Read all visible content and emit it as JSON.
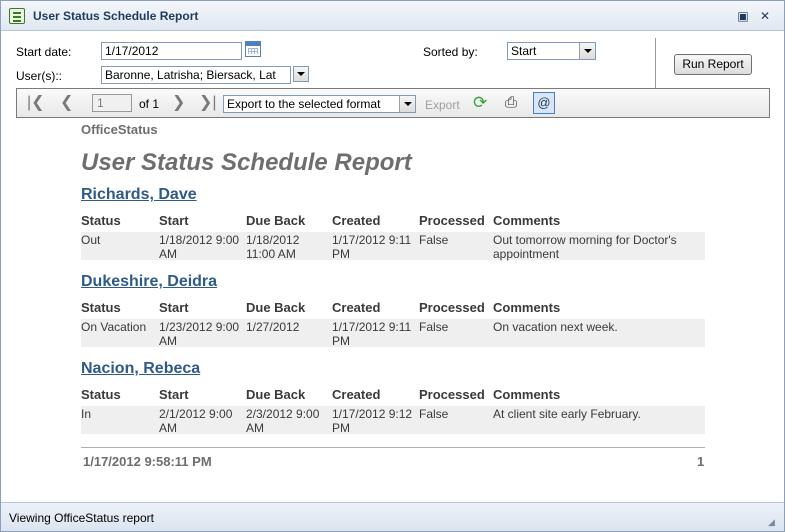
{
  "window": {
    "title": "User Status Schedule Report"
  },
  "params": {
    "start_date_label": "Start date:",
    "start_date_value": "1/17/2012",
    "users_label": "User(s)::",
    "users_value": "Baronne, Latrisha; Biersack, Lat",
    "sorted_by_label": "Sorted by:",
    "sorted_by_value": "Start",
    "run_report_label": "Run Report"
  },
  "toolbar": {
    "page_value": "1",
    "of_text": "of 1",
    "export_format": "Export to the selected format",
    "export_label": "Export"
  },
  "report": {
    "brand": "OfficeStatus",
    "title": "User Status Schedule Report",
    "columns": [
      "Status",
      "Start",
      "Due Back",
      "Created",
      "Processed",
      "Comments"
    ],
    "users": [
      {
        "name": "Richards, Dave",
        "status": "Out",
        "start": "1/18/2012 9:00 AM",
        "due_back": "1/18/2012 11:00 AM",
        "created": "1/17/2012 9:11 PM",
        "processed": "False",
        "comments": "Out tomorrow morning for Doctor's appointment"
      },
      {
        "name": "Dukeshire, Deidra",
        "status": "On Vacation",
        "start": "1/23/2012 9:00 AM",
        "due_back": "1/27/2012",
        "created": "1/17/2012 9:11 PM",
        "processed": "False",
        "comments": "On vacation next week."
      },
      {
        "name": "Nacion, Rebeca",
        "status": "In",
        "start": "2/1/2012 9:00 AM",
        "due_back": "2/3/2012 9:00 AM",
        "created": "1/17/2012 9:12 PM",
        "processed": "False",
        "comments": "At client site early February."
      }
    ],
    "footer_timestamp": "1/17/2012 9:58:11 PM",
    "footer_page": "1"
  },
  "status_bar": {
    "text": "Viewing OfficeStatus report"
  },
  "icons": {
    "first_page": "first-page-icon",
    "prev_page": "prev-page-icon",
    "next_page": "next-page-icon",
    "last_page": "last-page-icon",
    "refresh": "refresh-icon",
    "print": "printer-icon",
    "email": "email-icon",
    "calendar": "calendar-icon"
  },
  "colors": {
    "title_text": "#1f3a5a",
    "user_link": "#2e5a88",
    "report_gray": "#6e6e6e",
    "row_bg": "#efefef"
  }
}
